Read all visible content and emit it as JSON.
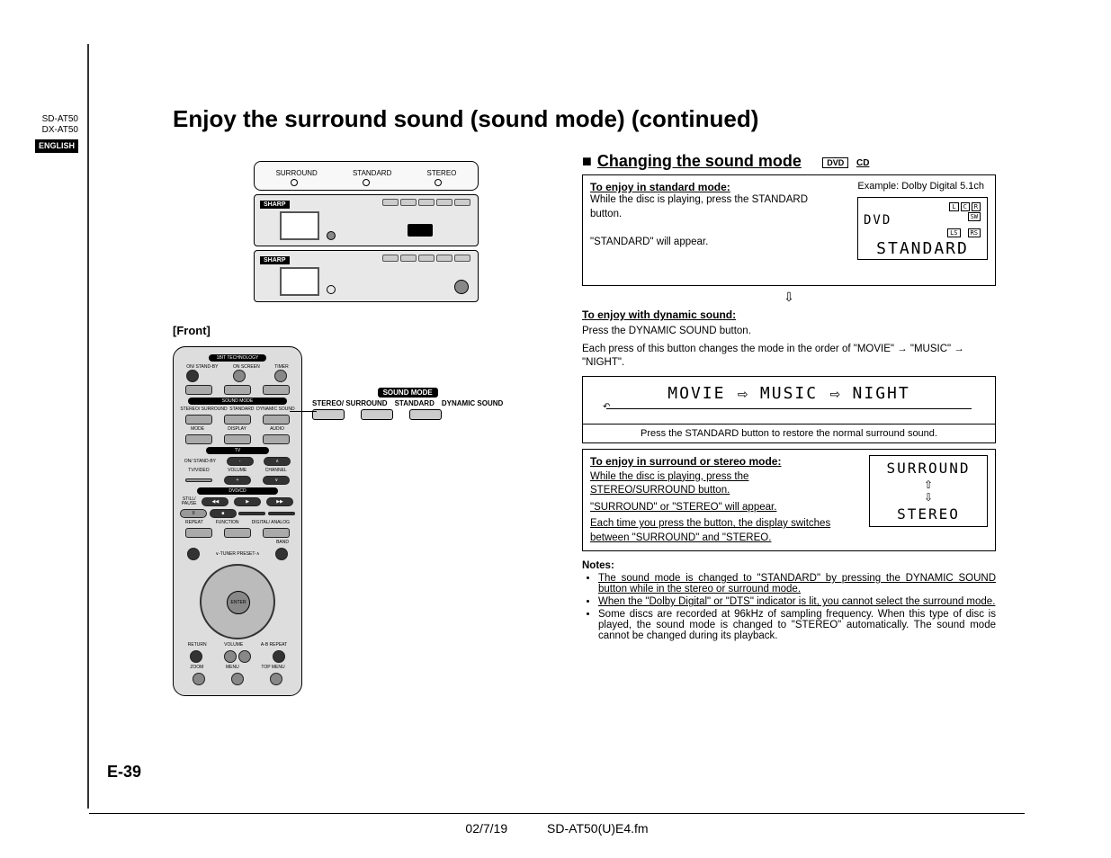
{
  "sidebar": {
    "model1": "SD-AT50",
    "model2": "DX-AT50",
    "language": "ENGLISH"
  },
  "page_title": "Enjoy the surround sound (sound mode) (continued)",
  "section_title": "Changing the sound mode",
  "badges": {
    "dvd": "DVD",
    "cd": "CD"
  },
  "remote_top_labels": [
    "SURROUND",
    "STANDARD",
    "STEREO"
  ],
  "device_brand": "SHARP",
  "front_label": "[Front]",
  "callout": {
    "header": "SOUND MODE",
    "items": [
      "STEREO/\nSURROUND",
      "STANDARD",
      "DYNAMIC\nSOUND"
    ]
  },
  "remote_labels": {
    "top_brand": "1BIT TECHNOLOGY",
    "row1": [
      "ON/\nSTAND-BY",
      "ON\nSCREEN",
      "TIMER"
    ],
    "soundmode_bar": "SOUND MODE",
    "soundmode_row": [
      "STEREO/\nSURROUND",
      "STANDARD",
      "DYNAMIC\nSOUND"
    ],
    "row_mda": [
      "MODE",
      "DISPLAY",
      "AUDIO"
    ],
    "tv_bar": "TV",
    "tv_row_top": [
      "ON/\nSTAND-BY",
      "-",
      "∧"
    ],
    "tv_row_bot": [
      "TV/VIDEO",
      "VOLUME",
      "CHANNEL"
    ],
    "dvdcd_bar": "DVD/CD",
    "row_rfd": [
      "REPEAT",
      "FUNCTION",
      "DIGITAL/\nANALOG"
    ],
    "band": "BAND",
    "tuner": "∨-TUNER PRESET-∧",
    "enter": "ENTER",
    "bottom_row": [
      "RETURN",
      "VOLUME",
      "A-B REPEAT"
    ],
    "last_row": [
      "ZOOM",
      "MENU",
      "TOP MENU"
    ]
  },
  "standard_mode": {
    "heading": "To enjoy in standard mode:",
    "example_label": "Example: Dolby Digital 5.1ch",
    "line1": "While the disc is playing, press the STANDARD button.",
    "line2": "\"STANDARD\" will appear.",
    "lcd_channels": [
      "L",
      "C",
      "R",
      "SW",
      "LS",
      "RS"
    ],
    "lcd_top": "DVD",
    "lcd_main": "STANDARD"
  },
  "dynamic": {
    "heading": "To enjoy with dynamic sound:",
    "line1": "Press the DYNAMIC SOUND button.",
    "line2_a": "Each press of this button changes the mode in the order of \"MOVIE\" ",
    "line2_b": " \"MUSIC\" ",
    "line2_c": " \"NIGHT\".",
    "modes": [
      "MOVIE",
      "MUSIC",
      "NIGHT"
    ],
    "restore": "Press the STANDARD button to restore the normal surround sound."
  },
  "surround": {
    "heading": "To enjoy in surround or stereo mode:",
    "line1": "While the disc is playing, press the STEREO/SURROUND button.",
    "line2": "\"SURROUND\" or \"STEREO\" will appear.",
    "line3": "Each time you press the button, the display switches between \"SURROUND\" and \"STEREO.",
    "lcd_a": "SURROUND",
    "lcd_b": "STEREO"
  },
  "notes": {
    "heading": "Notes:",
    "n1": "The sound mode is changed to \"STANDARD\" by pressing the DYNAMIC SOUND button while in the stereo or surround mode.",
    "n2": "When the \"Dolby Digital\" or \"DTS\" indicator is lit, you cannot select the surround mode.",
    "n3": "Some discs are recorded at 96kHz of sampling frequency. When this type of disc is played, the sound mode is changed to \"STEREO\" automatically. The sound mode cannot be changed during its playback."
  },
  "page_number": "E-39",
  "footer": {
    "date": "02/7/19",
    "file": "SD-AT50(U)E4.fm"
  }
}
